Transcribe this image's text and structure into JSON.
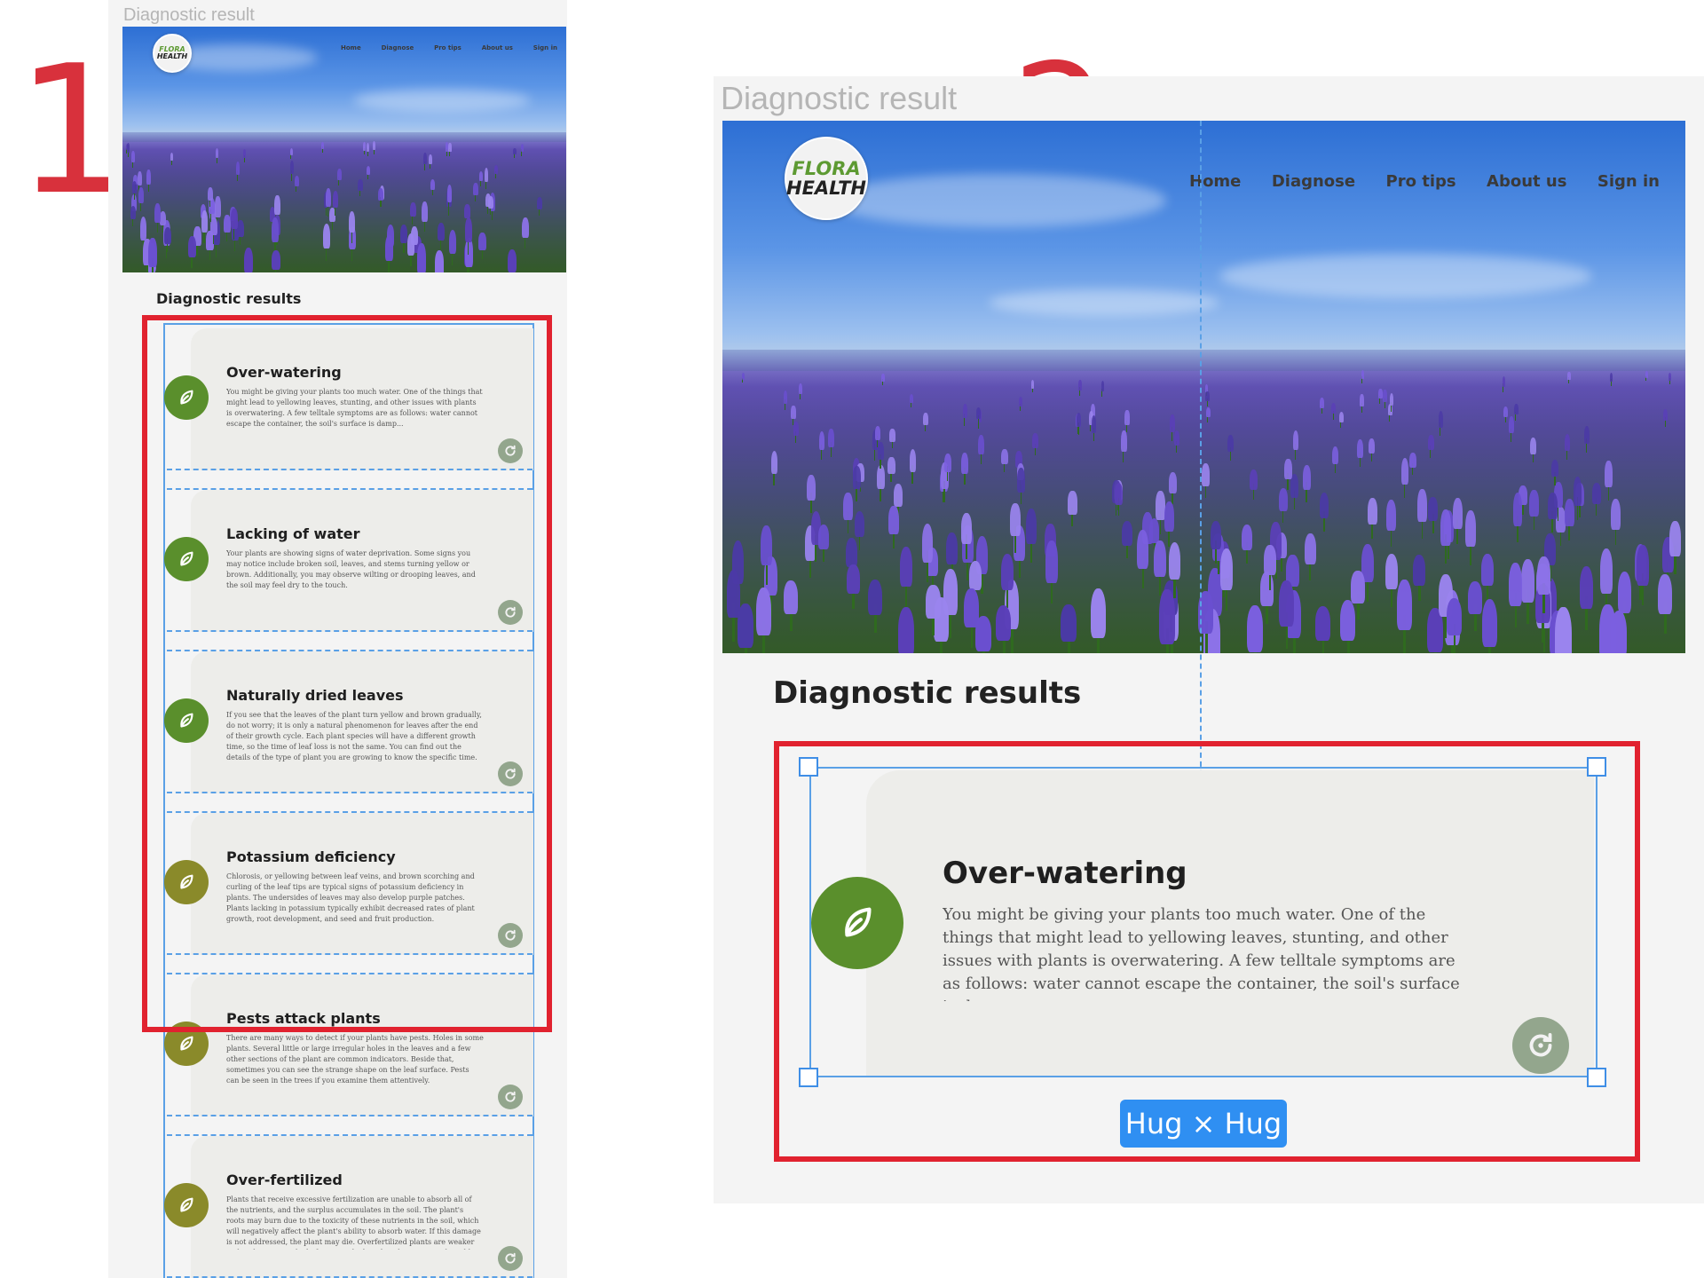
{
  "steps": [
    "1",
    "2"
  ],
  "frame_label": "Diagnostic result",
  "brand": {
    "line1": "FLORA",
    "line2": "HEALTH"
  },
  "nav": [
    "Home",
    "Diagnose",
    "Pro tips",
    "About us",
    "Sign in"
  ],
  "section_title": "Diagnostic results",
  "cards": [
    {
      "title": "Over-watering",
      "body": "You might be giving your plants too much water. One of the things that might lead to yellowing leaves, stunting, and other issues with plants is overwatering. A few telltale symptoms are as follows: water cannot escape the container, the soil's surface is damp...",
      "icon": "leaf-icon",
      "color": "#5a8f2c"
    },
    {
      "title": "Lacking of water",
      "body": "Your plants are showing signs of water deprivation. Some signs you may notice include broken soil, leaves, and stems turning yellow or brown. Additionally, you may observe wilting or drooping leaves, and the soil may feel dry to the touch.",
      "icon": "leaf-icon",
      "color": "#5a8f2c"
    },
    {
      "title": "Naturally dried leaves",
      "body": "If you see that the leaves of the plant turn yellow and brown gradually, do not worry; it is only a natural phenomenon for leaves after the end of their growth cycle. Each plant species will have a different growth time, so the time of leaf loss is not the same. You can find out the details of the type of plant you are growing to know the specific time.",
      "icon": "leaf-icon",
      "color": "#5a8f2c"
    },
    {
      "title": "Potassium deficiency",
      "body": "Chlorosis, or yellowing between leaf veins, and brown scorching and curling of the leaf tips are typical signs of potassium deficiency in plants. The undersides of leaves may also develop purple patches. Plants lacking in potassium typically exhibit decreased rates of plant growth, root development, and seed and fruit production.",
      "icon": "leaf-icon",
      "color": "#8a8a2a"
    },
    {
      "title": "Pests attack plants",
      "body": "There are many ways to detect if your plants have pests. Holes in some plants. Several little or large irregular holes in the leaves and a few other sections of the plant are common indicators. Beside that, sometimes you can see the strange shape on the leaf surface. Pests can be seen in the trees if you examine them attentively.",
      "icon": "leaf-icon",
      "color": "#8a8a2a"
    },
    {
      "title": "Over-fertilized",
      "body": "Plants that receive excessive fertilization are unable to absorb all of the nutrients, and the surplus accumulates in the soil. The plant's roots may burn due to the toxicity of these nutrients in the soil, which will negatively affect the plant's ability to absorb water. If this damage is not addressed, the plant may die. Overfertilized plants are weaker and under a great deal of stress, which makes them more vulnerable to insect and disease attacks.",
      "icon": "leaf-icon",
      "color": "#8a8a2a"
    }
  ],
  "detail_card_index": 0,
  "sizing_badge": "Hug × Hug",
  "colors": {
    "accent_red": "#e1222f",
    "selection_blue": "#5aa0e6",
    "leaf_green": "#5a8f2c",
    "leaf_olive": "#8a8a2a"
  }
}
